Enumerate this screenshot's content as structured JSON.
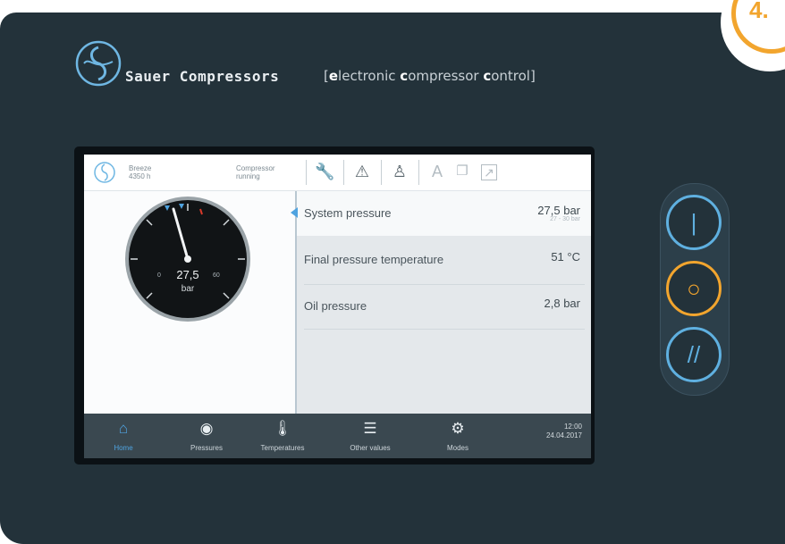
{
  "header": {
    "brand": "Sauer Compressors",
    "tagline_parts": [
      "[",
      "e",
      "lectronic ",
      "c",
      "ompressor ",
      "c",
      "ontrol]"
    ]
  },
  "badge": {
    "number": "4."
  },
  "screen": {
    "topbar": {
      "mode_name": "Breeze",
      "hours": "4350 h",
      "status_line1": "Compressor",
      "status_line2": "running",
      "icons": [
        "wrench-icon",
        "warning-icon",
        "user-icon",
        "font-icon",
        "copy-icon",
        "expand-icon"
      ],
      "font_glyph": "A"
    },
    "gauge": {
      "value": 27.5,
      "value_text": "27,5",
      "unit": "bar",
      "min_label": "0",
      "max_label": "60"
    },
    "readings": [
      {
        "label": "System pressure",
        "value": "27,5 bar",
        "sub": "27 - 30 bar",
        "selected": true
      },
      {
        "label": "Final pressure temperature",
        "value": "51 °C",
        "sub": "",
        "selected": false
      },
      {
        "label": "Oil pressure",
        "value": "2,8 bar",
        "sub": "",
        "selected": false
      }
    ],
    "nav": [
      {
        "label": "Home",
        "icon": "home-icon",
        "glyph": "⌂",
        "active": true
      },
      {
        "label": "Pressures",
        "icon": "compass-icon",
        "glyph": "◉",
        "active": false
      },
      {
        "label": "Temperatures",
        "icon": "thermometer-icon",
        "glyph": "🌡",
        "active": false
      },
      {
        "label": "Other values",
        "icon": "list-icon",
        "glyph": "☰",
        "active": false
      },
      {
        "label": "Modes",
        "icon": "gear-icon",
        "glyph": "⚙",
        "active": false
      }
    ],
    "clock": {
      "time": "12:00",
      "date": "24.04.2017"
    }
  },
  "side_buttons": [
    {
      "name": "power-on-button",
      "glyph": "|",
      "color": "#5fb0e0"
    },
    {
      "name": "standby-button",
      "glyph": "○",
      "color": "#f2a52e"
    },
    {
      "name": "power-off-button",
      "glyph": "//",
      "color": "#5fb0e0"
    }
  ]
}
